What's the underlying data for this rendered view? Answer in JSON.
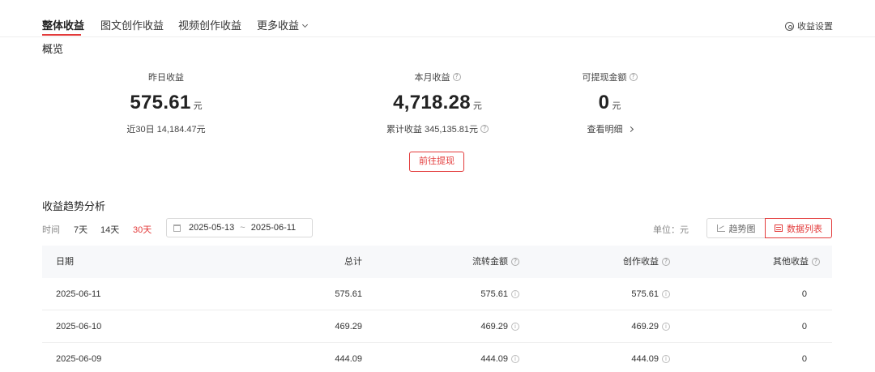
{
  "tabs": [
    {
      "label": "整体收益",
      "active": true
    },
    {
      "label": "图文创作收益",
      "active": false
    },
    {
      "label": "视频创作收益",
      "active": false
    },
    {
      "label": "更多收益",
      "active": false
    }
  ],
  "settings_label": "收益设置",
  "overview": {
    "title": "概览",
    "yesterday": {
      "label": "昨日收益",
      "value": "575.61",
      "unit": "元",
      "sub": "近30日 14,184.47元"
    },
    "month": {
      "label": "本月收益",
      "value": "4,718.28",
      "unit": "元",
      "sub": "累计收益 345,135.81元"
    },
    "withdrawable": {
      "label": "可提现金额",
      "value": "0",
      "unit": "元",
      "sub": "查看明细"
    },
    "withdraw_button": "前往提现"
  },
  "trend": {
    "title": "收益趋势分析",
    "time_label": "时间",
    "ranges": [
      "7天",
      "14天",
      "30天"
    ],
    "active_range": "30天",
    "date_start": "2025-05-13",
    "date_sep": "~",
    "date_end": "2025-06-11",
    "unit_label": "单位：元",
    "view_trend": "趋势图",
    "view_list": "数据列表"
  },
  "table": {
    "headers": {
      "date": "日期",
      "total": "总计",
      "flow": "流转金额",
      "creation": "创作收益",
      "other": "其他收益"
    },
    "rows": [
      {
        "date": "2025-06-11",
        "total": "575.61",
        "flow": "575.61",
        "creation": "575.61",
        "other": "0"
      },
      {
        "date": "2025-06-10",
        "total": "469.29",
        "flow": "469.29",
        "creation": "469.29",
        "other": "0"
      },
      {
        "date": "2025-06-09",
        "total": "444.09",
        "flow": "444.09",
        "creation": "444.09",
        "other": "0"
      }
    ]
  },
  "colors": {
    "accent": "#e33b3b",
    "header_bg": "#f7f8fa"
  }
}
